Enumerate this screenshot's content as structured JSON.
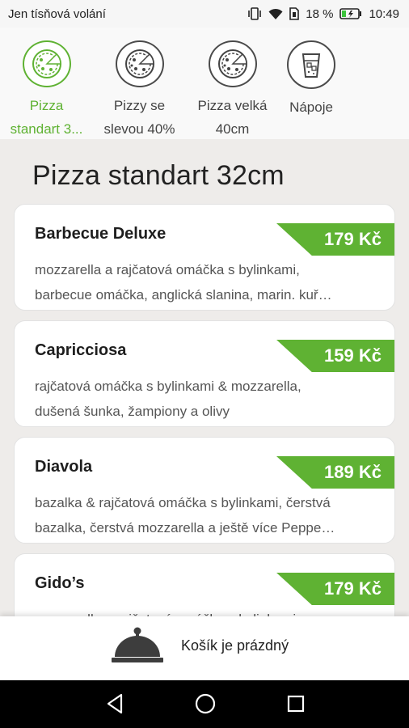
{
  "status": {
    "carrier": "Jen tísňová volání",
    "battery": "18 %",
    "time": "10:49"
  },
  "categories": [
    {
      "label": "Pizza standart 3...",
      "line1": "Pizza",
      "line2": "standart 3...",
      "icon": "pizza-icon",
      "active": true
    },
    {
      "label": "Pizzy se slevou 40%",
      "line1": "Pizzy se",
      "line2": "slevou 40%",
      "icon": "pizza-icon",
      "active": false
    },
    {
      "label": "Pizza velká 40cm",
      "line1": "Pizza velká",
      "line2": "40cm",
      "icon": "pizza-icon",
      "active": false
    },
    {
      "label": "Nápoje",
      "line1": "Nápoje",
      "line2": "",
      "icon": "drink-icon",
      "active": false
    }
  ],
  "section": {
    "title": "Pizza standart 32cm"
  },
  "items": [
    {
      "name": "Barbecue Deluxe",
      "price": "179 Kč",
      "desc1": "mozzarella a rajčatová omáčka s bylinkami,",
      "desc2": "barbecue omáčka, anglická slanina, marin. kuř…"
    },
    {
      "name": "Capricciosa",
      "price": "159 Kč",
      "desc1": "rajčatová omáčka s bylinkami & mozzarella,",
      "desc2": "dušená šunka, žampiony a olivy"
    },
    {
      "name": "Diavola",
      "price": "189 Kč",
      "desc1": "bazalka & rajčatová omáčka s bylinkami, čerstvá",
      "desc2": "bazalka, čerstvá mozzarella a ještě více Peppe…"
    },
    {
      "name": "Gido’s",
      "price": "179 Kč",
      "desc1": "mozzarella a rajčatová omáčka s bylinkami,",
      "desc2": ""
    }
  ],
  "cart": {
    "text": "Košík je prázdný",
    "icon": "cloche-icon"
  },
  "colors": {
    "accent": "#5fb233",
    "background": "#eeecea"
  }
}
